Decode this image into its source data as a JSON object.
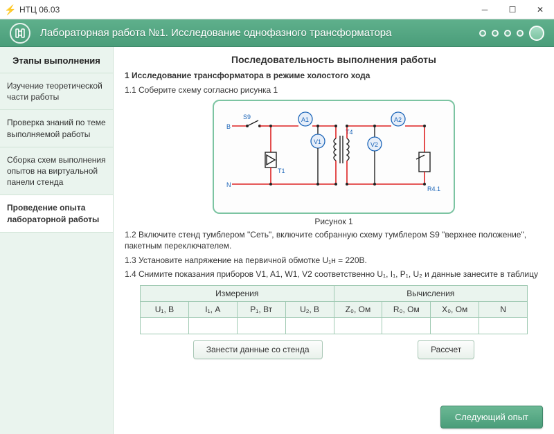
{
  "window": {
    "title": "НТЦ 06.03"
  },
  "header": {
    "title": "Лабораторная работа №1. Исследование однофазного трансформатора"
  },
  "sidebar": {
    "title": "Этапы выполнения",
    "items": [
      {
        "label": "Изучение теоретической части работы"
      },
      {
        "label": "Проверка знаний по теме выполняемой работы"
      },
      {
        "label": "Сборка схем выполнения опытов на виртуальной панели стенда"
      },
      {
        "label": "Проведение опыта лабораторной работы"
      }
    ],
    "active_index": 3
  },
  "main": {
    "title": "Последовательность выполнения работы",
    "s1_title": "1 Исследование трансформатора в режиме холостого хода",
    "s1_1": "1.1 Соберите схему согласно рисунка 1",
    "figure_caption": "Рисунок 1",
    "s1_2": "1.2 Включите стенд тумблером \"Сеть\", включите собранную схему  тумблером S9 \"верхнее положение\", пакетным переключателем.",
    "s1_3": "1.3 Установите напряжение на первичной обмотке U₁н = 220В.",
    "s1_4": "1.4 Снимите показания приборов  V1, A1, W1, V2 соответственно U₁, I₁, P₁, U₂ и данные занесите в таблицу",
    "table": {
      "group_meas": "Измерения",
      "group_calc": "Вычисления",
      "cols": [
        "U₁, В",
        "I₁, А",
        "P₁, Вт",
        "U₂, В",
        "Z₀, Ом",
        "R₀, Ом",
        "X₀, Ом",
        "N"
      ]
    },
    "btn_load": "Занести данные со стенда",
    "btn_calc": "Рассчет",
    "btn_next": "Следующий опыт"
  },
  "circuit": {
    "S9": "S9",
    "B": "B",
    "N": "N",
    "T1": "T1",
    "T4": "T4",
    "A1": "A1",
    "V1": "V1",
    "A2": "A2",
    "V2": "V2",
    "R41": "R4.1"
  }
}
